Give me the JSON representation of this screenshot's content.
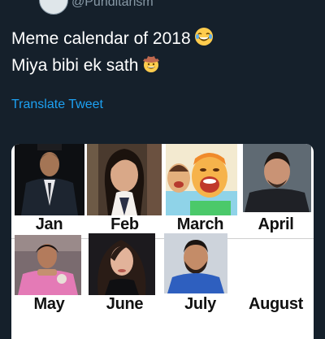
{
  "tweet": {
    "handle": "@Punditarism",
    "text_line1": "Meme calendar of 2018",
    "text_line2": "Miya bibi ek sath",
    "translate_label": "Translate Tweet"
  },
  "calendar": {
    "months": [
      "Jan",
      "Feb",
      "March",
      "April",
      "May",
      "June",
      "July",
      "August"
    ]
  },
  "colors": {
    "background": "#15202b",
    "text": "#ffffff",
    "link": "#1da1f2",
    "muted": "#8899a6"
  },
  "icons": [
    "laughing-emoji-icon",
    "cowboy-emoji-icon"
  ]
}
